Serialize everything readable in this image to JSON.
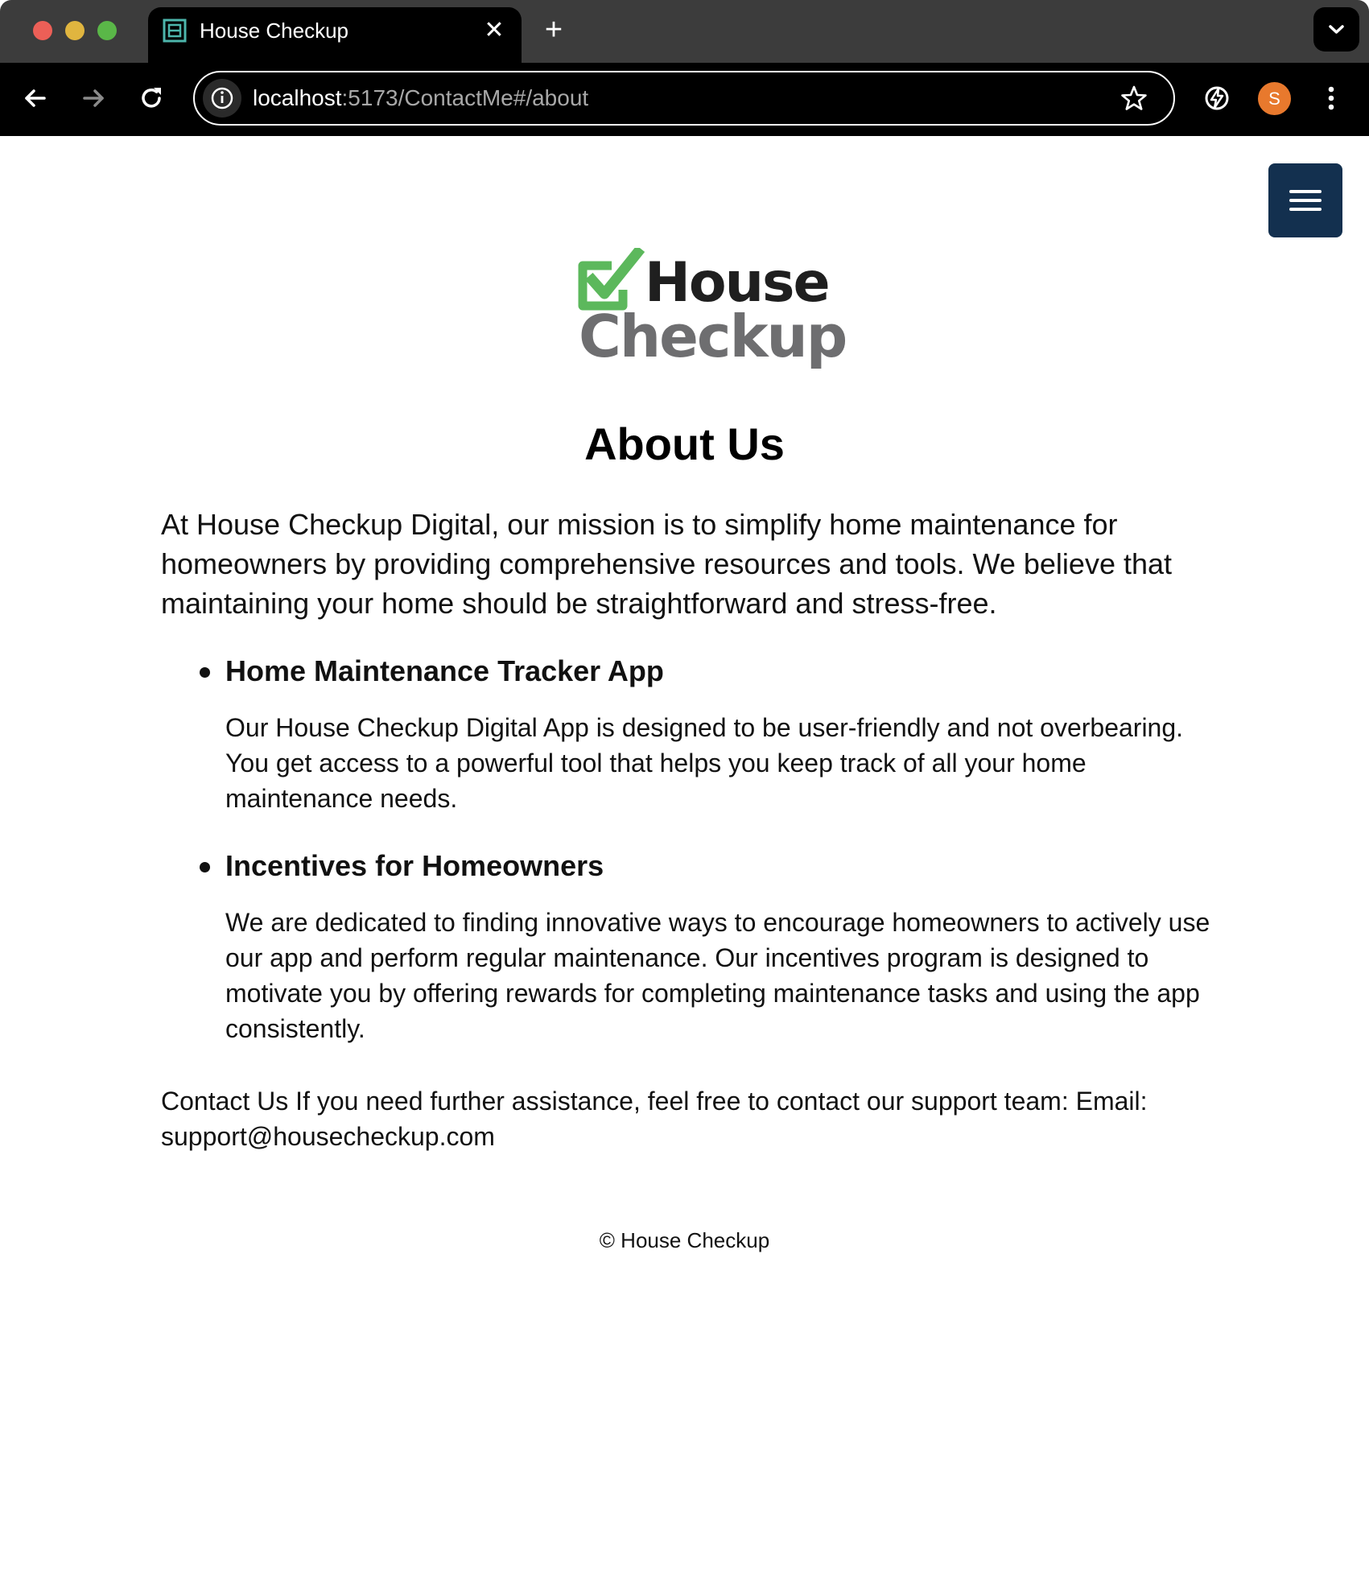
{
  "browser": {
    "tab_title": "House Checkup",
    "url_host": "localhost",
    "url_path": ":5173/ContactMe#/about",
    "avatar_initial": "S"
  },
  "logo": {
    "line1": "House",
    "line2": "Checkup",
    "check_color": "#5cb85c"
  },
  "page": {
    "title": "About Us",
    "intro": "At House Checkup Digital, our mission is to simplify home maintenance for homeowners by providing comprehensive resources and tools. We believe that maintaining your home should be straightforward and stress-free.",
    "features": [
      {
        "title": "Home Maintenance Tracker App",
        "description": "Our House Checkup Digital App is designed to be user-friendly and not overbearing. You get access to a powerful tool that helps you keep track of all your home maintenance needs."
      },
      {
        "title": "Incentives for Homeowners",
        "description": "We are dedicated to finding innovative ways to encourage homeowners to actively use our app and perform regular maintenance. Our incentives program is designed to motivate you by offering rewards for completing maintenance tasks and using the app consistently."
      }
    ],
    "contact": "Contact Us If you need further assistance, feel free to contact our support team: Email: support@housecheckup.com",
    "footer": "© House Checkup"
  },
  "colors": {
    "menu_button": "#13304f",
    "avatar": "#e8792d"
  }
}
